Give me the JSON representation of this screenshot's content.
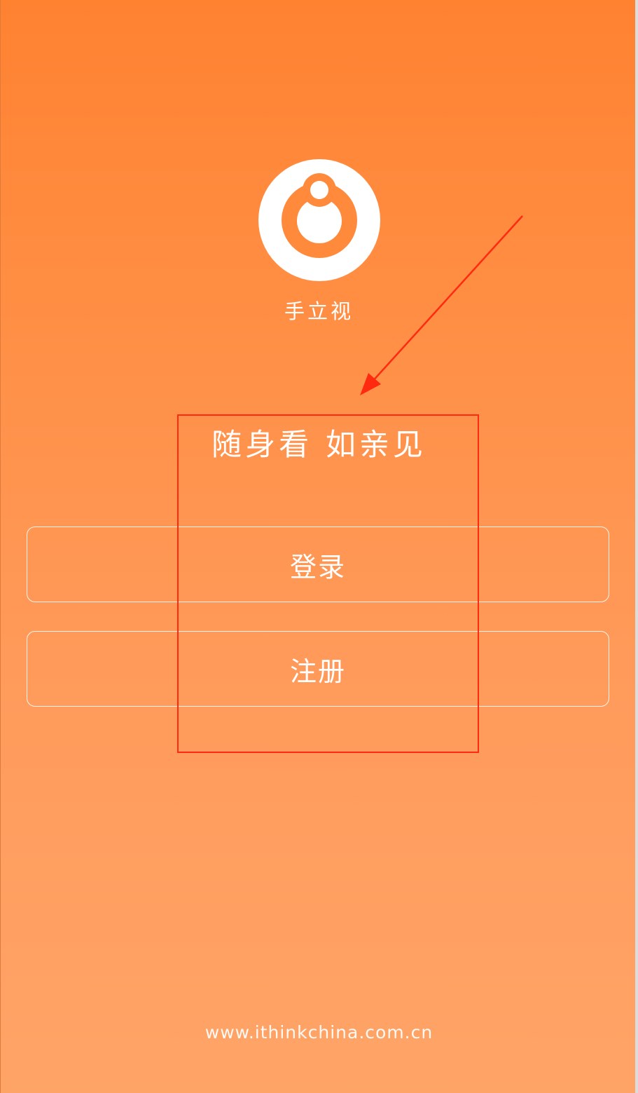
{
  "app": {
    "name": "手立视",
    "slogan": "随身看 如亲见",
    "logo_icon": "app-logo-icon"
  },
  "actions": {
    "login_label": "登录",
    "register_label": "注册"
  },
  "footer": {
    "url": "www.ithinkchina.com.cn"
  },
  "colors": {
    "background_top": "#ff8231",
    "background_bottom": "#ffa467",
    "text": "#ffffff",
    "annotation": "#ff2a10"
  }
}
